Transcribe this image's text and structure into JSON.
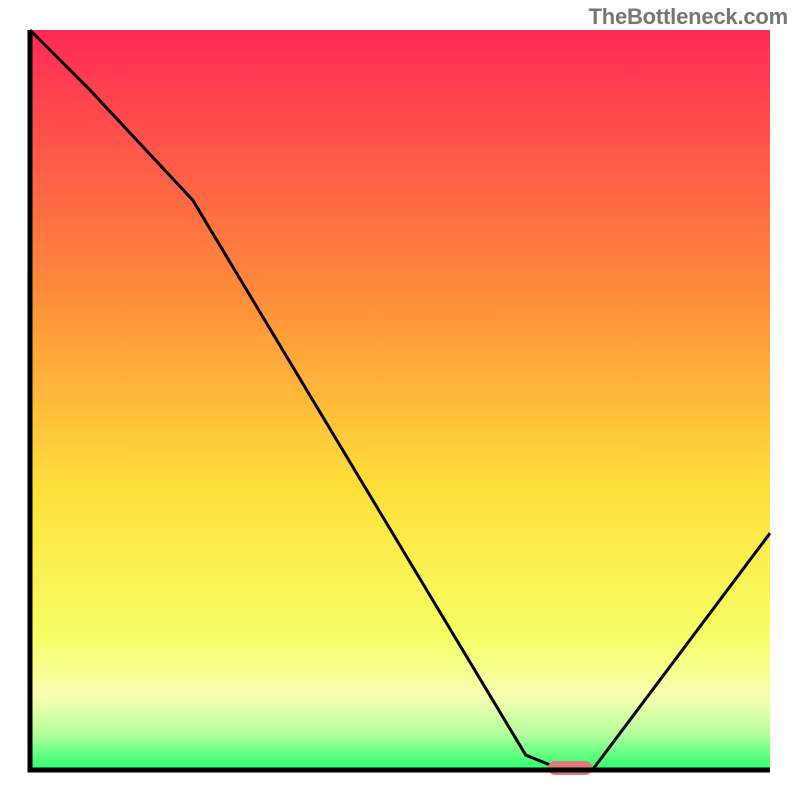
{
  "attribution": "TheBottleneck.com",
  "colors": {
    "top": "#ff2a55",
    "mid_upper": "#ff8a3a",
    "mid": "#ffe03a",
    "mid_lower": "#f6ff66",
    "band_yellow": "#f8ffb0",
    "band_green_light": "#b6ff9e",
    "bottom_green": "#29ff6c",
    "curve": "#000000",
    "marker": "#e07a7e",
    "axis": "#000000"
  },
  "chart_data": {
    "type": "line",
    "title": "",
    "xlabel": "",
    "ylabel": "",
    "xlim": [
      0,
      100
    ],
    "ylim": [
      0,
      100
    ],
    "x": [
      0,
      8,
      22,
      67,
      72,
      76,
      100
    ],
    "values": [
      100,
      92,
      77,
      2,
      0,
      0,
      32
    ],
    "marker": {
      "x_start": 70,
      "x_end": 76,
      "y": 0
    },
    "annotations": []
  }
}
